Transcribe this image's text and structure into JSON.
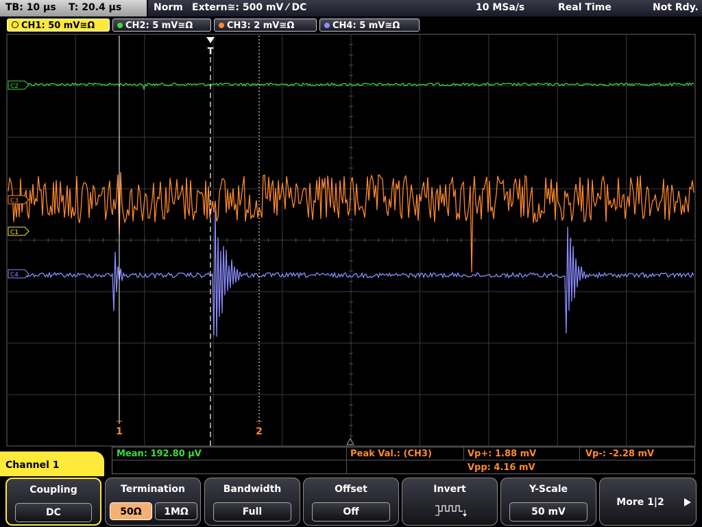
{
  "header": {
    "timebase": "TB: 10 µs",
    "trigger_time": "T: 20.4 µs",
    "mode": "Norm",
    "trigger_source": "Extern≅: 500 mV ⁄ DC",
    "sample_rate": "10 MSa/s",
    "acq_mode": "Real Time",
    "status": "Not Rdy."
  },
  "channels": [
    {
      "label": "CH1: 50 mV≅Ω",
      "color": "#ffea3a",
      "active": true
    },
    {
      "label": "CH2: 5 mV≅Ω",
      "color": "#3adc3a",
      "active": false
    },
    {
      "label": "CH3: 2 mV≅Ω",
      "color": "#ff8a2a",
      "active": false
    },
    {
      "label": "CH4: 5 mV≅Ω",
      "color": "#8c8cff",
      "active": false
    }
  ],
  "markers": {
    "trigger": "T",
    "cursor1": "1",
    "cursor2": "2",
    "ch1_marker": "C1",
    "ch2_marker": "C2",
    "ch3_marker": "C3",
    "ch4_marker": "C4"
  },
  "measurements": {
    "mean": "Mean: 192.80 µV",
    "peak_title": "Peak Val.:  (CH3)",
    "vp_plus": "Vp+: 1.88 mV",
    "vp_minus": "Vp-: -2.28 mV",
    "vpp": "Vpp: 4.16 mV"
  },
  "menu": {
    "title": "Channel 1",
    "coupling_label": "Coupling",
    "coupling_value": "DC",
    "termination_label": "Termination",
    "term_50": "50Ω",
    "term_1m": "1MΩ",
    "bandwidth_label": "Bandwidth",
    "bandwidth_value": "Full",
    "offset_label": "Offset",
    "offset_value": "Off",
    "invert_label": "Invert",
    "yscale_label": "Y-Scale",
    "yscale_value": "50 mV",
    "more_label": "More 1|2"
  },
  "colors": {
    "ch1": "#ffea3a",
    "ch2": "#3adc3a",
    "ch3": "#ff8a2a",
    "ch4": "#8c8cff",
    "measure_green": "#3adc3a",
    "measure_orange": "#ff8a2a"
  }
}
